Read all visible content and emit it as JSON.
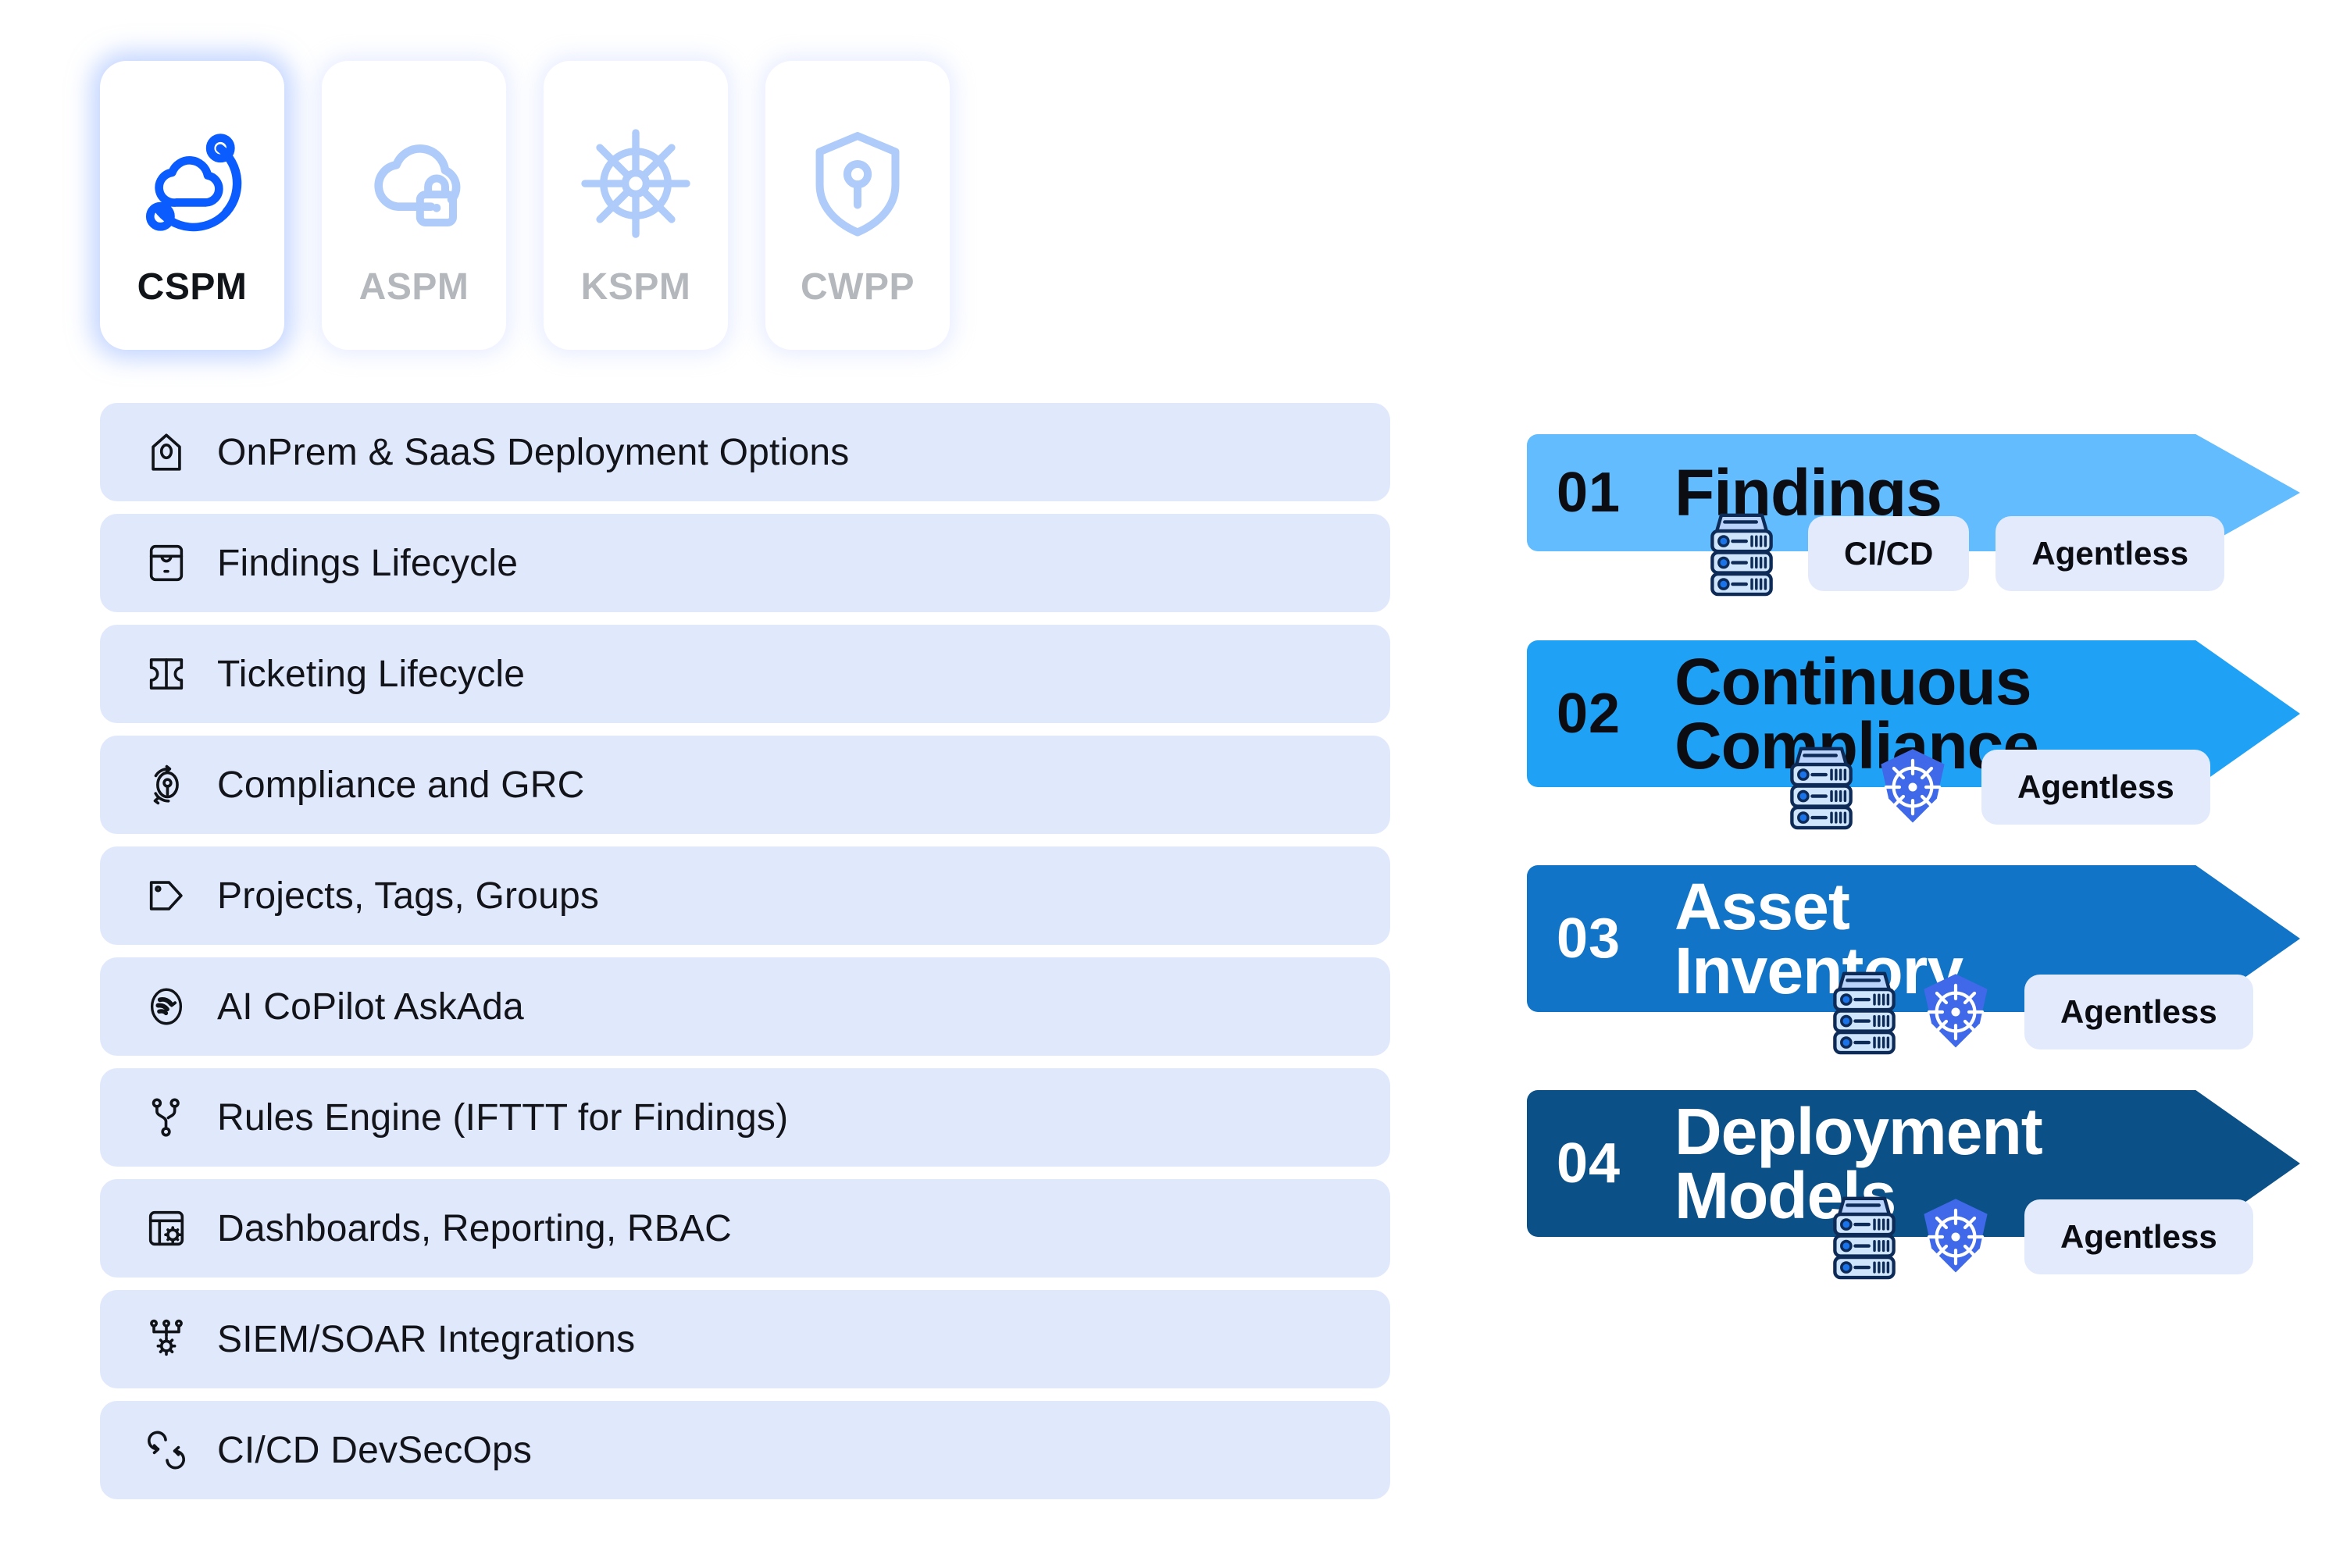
{
  "tabs": [
    {
      "label": "CSPM",
      "icon": "cloud-orbit-icon",
      "active": true,
      "accent": "#0b5cff"
    },
    {
      "label": "ASPM",
      "icon": "cloud-lock-icon",
      "active": false,
      "accent": "#aecbfa"
    },
    {
      "label": "KSPM",
      "icon": "ship-wheel-icon",
      "active": false,
      "accent": "#aecbfa"
    },
    {
      "label": "CWPP",
      "icon": "shield-keyhole-icon",
      "active": false,
      "accent": "#aecbfa"
    }
  ],
  "features": [
    {
      "label": "OnPrem & SaaS Deployment Options",
      "icon": "home-scan-icon"
    },
    {
      "label": "Findings Lifecycle",
      "icon": "inbox-archive-icon"
    },
    {
      "label": "Ticketing Lifecycle",
      "icon": "ticket-icon"
    },
    {
      "label": "Compliance and GRC",
      "icon": "compliance-refresh-icon"
    },
    {
      "label": "Projects, Tags, Groups",
      "icon": "tag-icon"
    },
    {
      "label": "AI CoPilot AskAda",
      "icon": "ai-assistant-icon"
    },
    {
      "label": "Rules Engine (IFTTT for Findings)",
      "icon": "rules-branch-icon"
    },
    {
      "label": "Dashboards, Reporting, RBAC",
      "icon": "dashboard-gear-icon"
    },
    {
      "label": "SIEM/SOAR Integrations",
      "icon": "siem-gear-icon"
    },
    {
      "label": "CI/CD DevSecOps",
      "icon": "cicd-loop-icon"
    }
  ],
  "feature_list_bg": "#e0e8fc",
  "banners": [
    {
      "number": "01",
      "title": "Findings",
      "color": "#62bcfd",
      "text_color": "#0b0d12",
      "icons": [
        "server-stack-icon"
      ],
      "chips": [
        "CI/CD",
        "Agentless"
      ]
    },
    {
      "number": "02",
      "title": "Continuous\nCompliance",
      "color": "#1fa2f6",
      "text_color": "#0b0d12",
      "icons": [
        "server-stack-icon",
        "kubernetes-icon"
      ],
      "chips": [
        "Agentless"
      ]
    },
    {
      "number": "03",
      "title": "Asset\nInventory",
      "color": "#1274c6",
      "text_color": "#ffffff",
      "icons": [
        "server-stack-icon",
        "kubernetes-icon"
      ],
      "chips": [
        "Agentless"
      ]
    },
    {
      "number": "04",
      "title": "Deployment\nModels",
      "color": "#0b5087",
      "text_color": "#ffffff",
      "icons": [
        "server-stack-icon",
        "kubernetes-icon"
      ],
      "chips": [
        "Agentless"
      ]
    }
  ],
  "chip_bg": "#e2eafc"
}
